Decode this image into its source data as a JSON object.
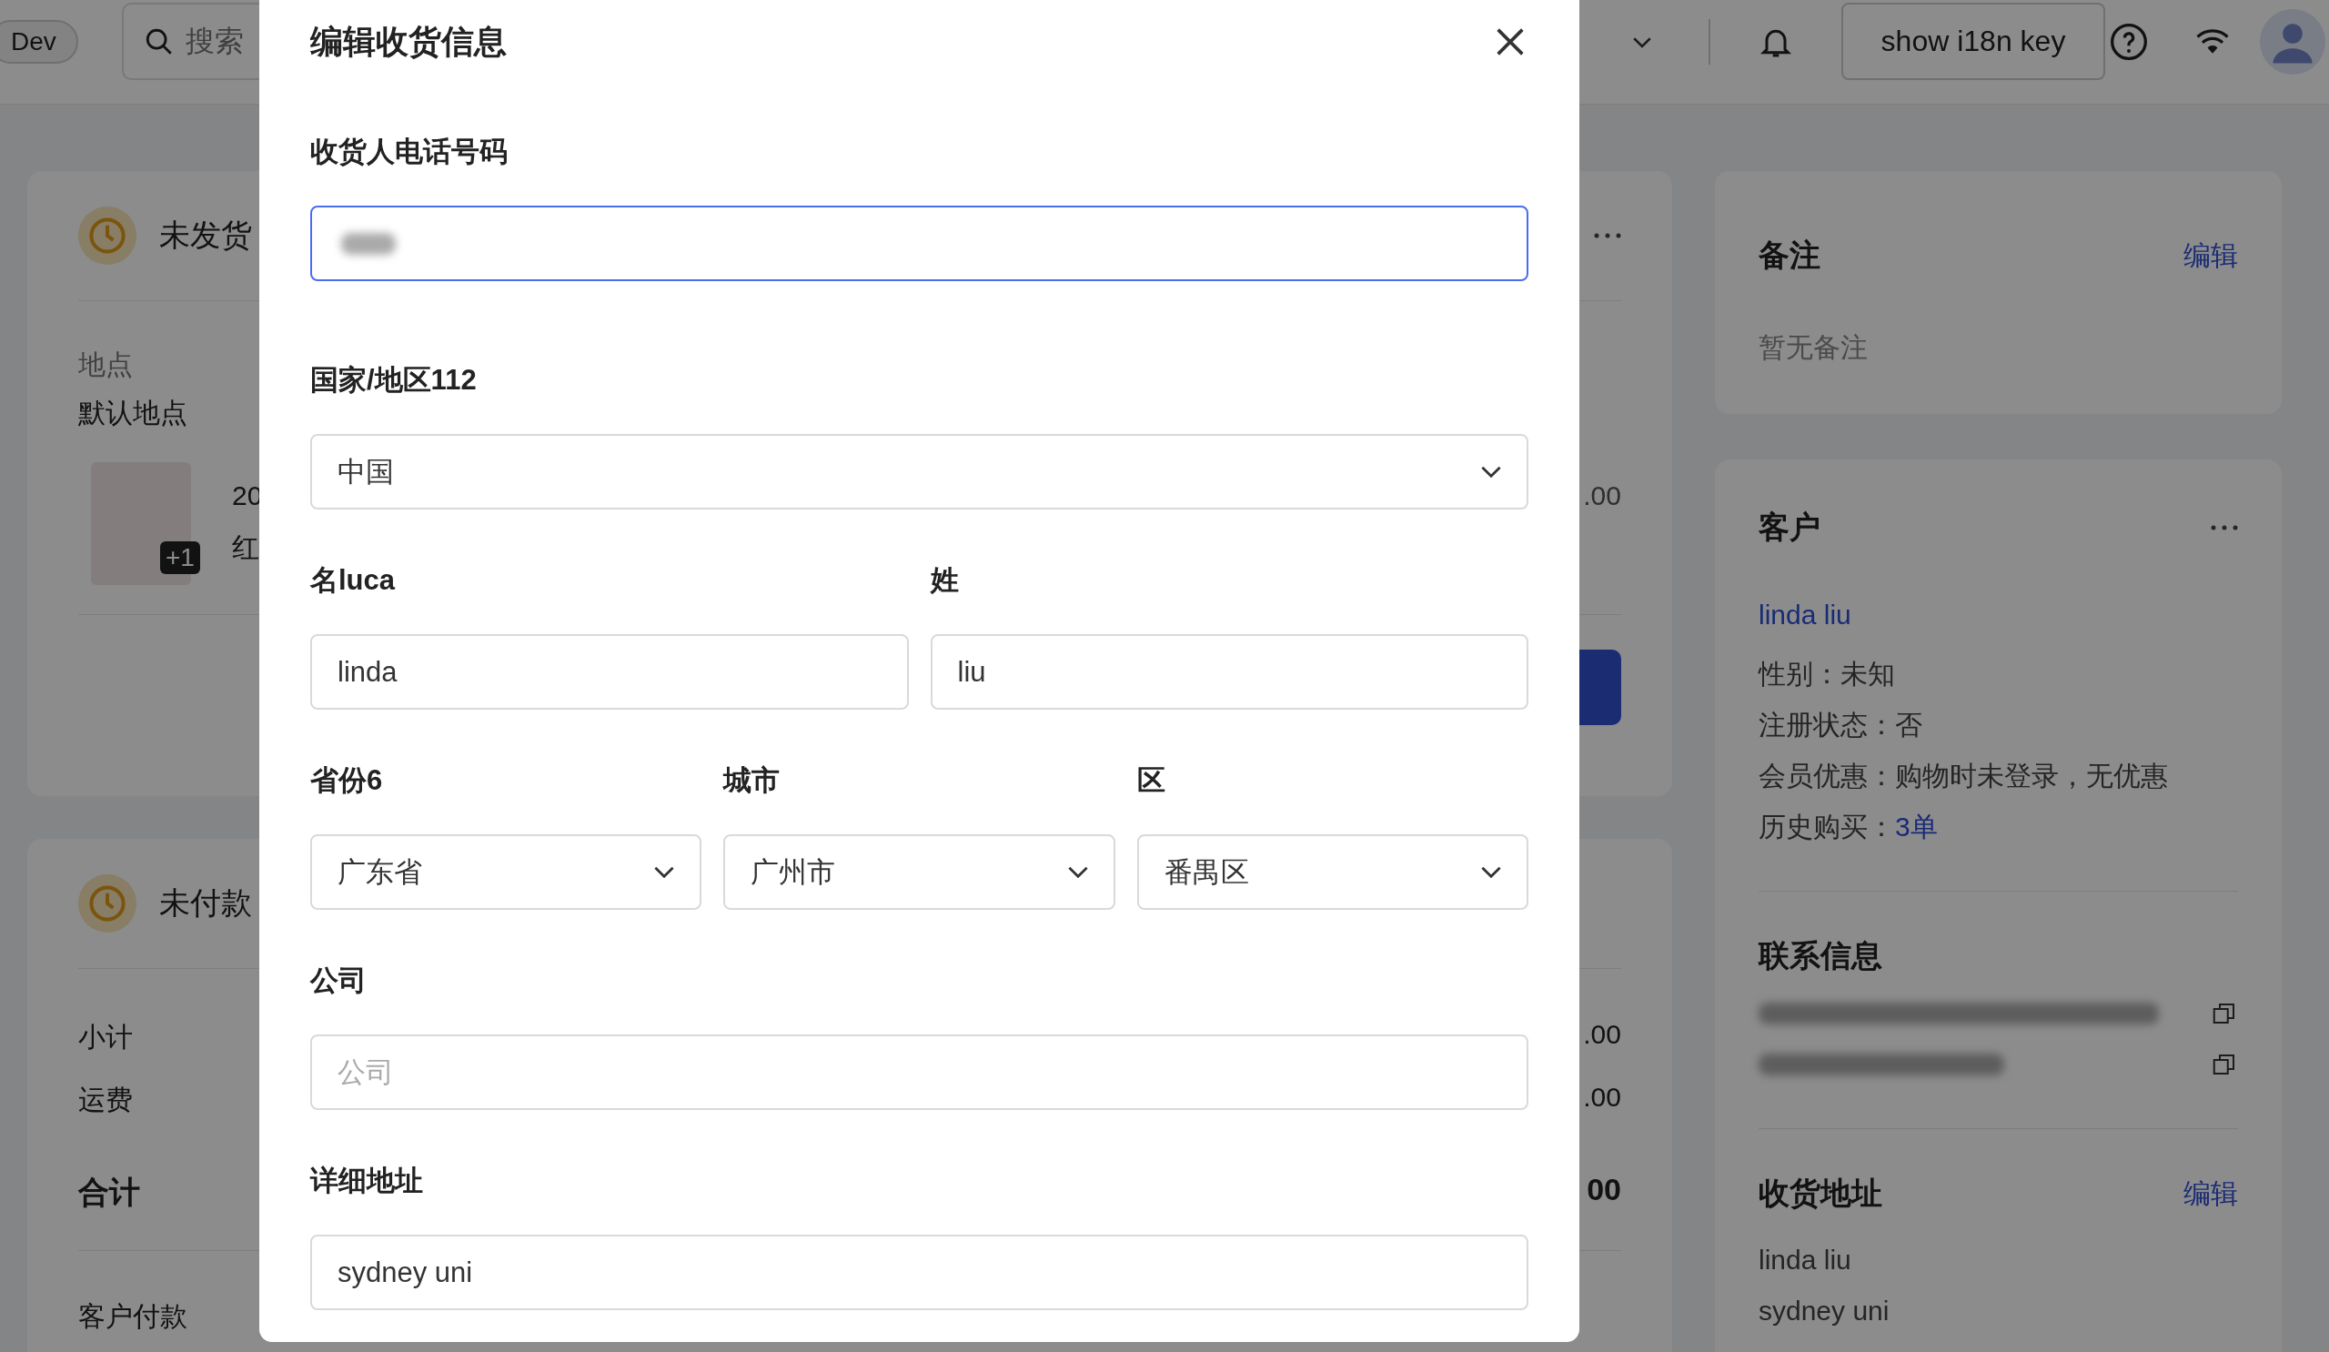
{
  "top_bar": {
    "env_badge": "Dev",
    "search": {
      "placeholder": "搜索"
    },
    "i18n_button": "show i18n key"
  },
  "unfulfilled_card": {
    "title": "未发货",
    "location_label": "地点",
    "location": "默认地点",
    "item_title": "20",
    "item_variant": "红",
    "extra_count": "+1",
    "amount": ".00"
  },
  "unpaid_card": {
    "title": "未付款",
    "lines": [
      {
        "label": "小计",
        "amount": ".00",
        "bold": false
      },
      {
        "label": "运费",
        "amount": ".00",
        "bold": false
      },
      {
        "label": "合计",
        "amount": "00",
        "bold": true
      }
    ],
    "paid_label": "客户付款"
  },
  "note_card": {
    "title": "备注",
    "edit_link": "编辑",
    "empty_text": "暂无备注"
  },
  "customer_card": {
    "title": "客户",
    "name_link": "linda liu",
    "details": [
      {
        "label": "性别：",
        "value": "未知",
        "link": false
      },
      {
        "label": "注册状态：",
        "value": "否",
        "link": false
      },
      {
        "label": "会员优惠：",
        "value": "购物时未登录，无优惠",
        "link": false
      },
      {
        "label": "历史购买：",
        "value": "3单",
        "link": true
      }
    ],
    "contact_title": "联系信息",
    "address_title": "收货地址",
    "address_edit_link": "编辑",
    "address_lines": [
      "linda liu",
      "sydney uni"
    ]
  },
  "dialog": {
    "title": "编辑收货信息",
    "rows": [
      {
        "fields": [
          {
            "kind": "phone",
            "label": "收货人电话号码",
            "focused": true
          }
        ]
      },
      {
        "fields": [
          {
            "kind": "select",
            "label": "国家/地区112",
            "value": "中国",
            "focused": false
          }
        ]
      },
      {
        "fields": [
          {
            "kind": "text",
            "label": "名luca",
            "value": "linda",
            "focused": false
          },
          {
            "kind": "text",
            "label": "姓",
            "value": "liu",
            "focused": false
          }
        ]
      },
      {
        "fields": [
          {
            "kind": "select",
            "label": "省份6",
            "value": "广东省",
            "focused": false
          },
          {
            "kind": "select",
            "label": "城市",
            "value": "广州市",
            "focused": false
          },
          {
            "kind": "select",
            "label": "区",
            "value": "番禺区",
            "focused": false
          }
        ]
      },
      {
        "fields": [
          {
            "kind": "text",
            "label": "公司",
            "placeholder": "公司",
            "focused": false
          }
        ]
      },
      {
        "fields": [
          {
            "kind": "text",
            "label": "详细地址",
            "value": "sydney uni",
            "focused": false
          }
        ]
      }
    ]
  }
}
